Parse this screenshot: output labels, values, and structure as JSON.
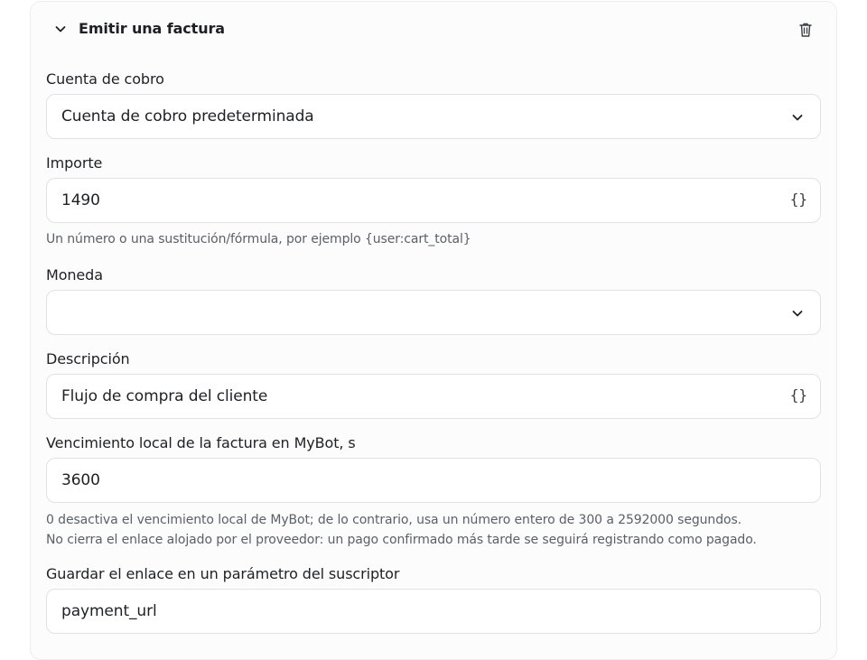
{
  "section": {
    "title": "Emitir una factura",
    "toggle_icon": "chevron-down-icon",
    "delete_icon": "trash-icon"
  },
  "fields": {
    "account": {
      "label": "Cuenta de cobro",
      "value": "Cuenta de cobro predeterminada",
      "icon": "chevron-down-icon"
    },
    "amount": {
      "label": "Importe",
      "value": "1490",
      "variable_button": "{}",
      "hint": "Un número o una sustitución/fórmula, por ejemplo {user:cart_total}"
    },
    "currency": {
      "label": "Moneda",
      "value": "",
      "icon": "chevron-down-icon"
    },
    "description": {
      "label": "Descripción",
      "value": "Flujo de compra del cliente",
      "variable_button": "{}"
    },
    "expiration": {
      "label": "Vencimiento local de la factura en MyBot, s",
      "value": "3600",
      "hint_line1": "0 desactiva el vencimiento local de MyBot; de lo contrario, usa un número entero de 300 a 2592000 segundos.",
      "hint_line2": "No cierra el enlace alojado por el proveedor: un pago confirmado más tarde se seguirá registrando como pagado."
    },
    "save_link": {
      "label": "Guardar el enlace en un parámetro del suscriptor",
      "value": "payment_url"
    }
  }
}
